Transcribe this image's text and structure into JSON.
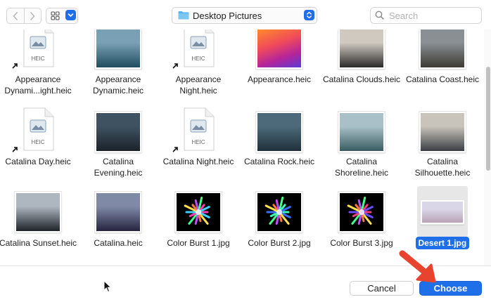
{
  "toolbar": {
    "location_label": "Desktop Pictures",
    "search_placeholder": "Search"
  },
  "files": [
    {
      "name": "Appearance Dynami...ight.heic",
      "kind": "heic",
      "alias": true
    },
    {
      "name": "Appearance Dynamic.heic",
      "kind": "photo",
      "colors": [
        "#7aa0b6",
        "#1f4c5e"
      ]
    },
    {
      "name": "Appearance Night.heic",
      "kind": "heic",
      "alias": true
    },
    {
      "name": "Appearance.heic",
      "kind": "photo",
      "colors": [
        "#f06a2a",
        "#b5249a"
      ]
    },
    {
      "name": "Catalina Clouds.heic",
      "kind": "photo",
      "colors": [
        "#cfc9c0",
        "#2a2a2a"
      ]
    },
    {
      "name": "Catalina Coast.heic",
      "kind": "photo",
      "colors": [
        "#8a8f93",
        "#3c3a33"
      ]
    },
    {
      "name": "Catalina Day.heic",
      "kind": "heic",
      "alias": true
    },
    {
      "name": "Catalina Evening.heic",
      "kind": "photo",
      "colors": [
        "#3e5262",
        "#1c2229"
      ]
    },
    {
      "name": "Catalina Night.heic",
      "kind": "heic",
      "alias": true
    },
    {
      "name": "Catalina Rock.heic",
      "kind": "photo",
      "colors": [
        "#4c6a7a",
        "#20303a"
      ]
    },
    {
      "name": "Catalina Shoreline.heic",
      "kind": "photo",
      "colors": [
        "#a9c0c8",
        "#3a5c62"
      ]
    },
    {
      "name": "Catalina Silhouette.heic",
      "kind": "photo",
      "colors": [
        "#c9c4bb",
        "#3a3e44"
      ]
    },
    {
      "name": "Catalina Sunset.heic",
      "kind": "photo",
      "colors": [
        "#aeb6c0",
        "#1d2328"
      ]
    },
    {
      "name": "Catalina.heic",
      "kind": "photo",
      "colors": [
        "#7f8aa7",
        "#26233f"
      ]
    },
    {
      "name": "Color Burst 1.jpg",
      "kind": "burst",
      "colors": [
        "#ff3cb0",
        "#3fd0ff"
      ]
    },
    {
      "name": "Color Burst 2.jpg",
      "kind": "burst",
      "colors": [
        "#3cffb5",
        "#3c6dff"
      ]
    },
    {
      "name": "Color Burst 3.jpg",
      "kind": "burst",
      "colors": [
        "#ff3c7a",
        "#6c4cff"
      ]
    },
    {
      "name": "Desert 1.jpg",
      "kind": "photo",
      "selected": true,
      "colors": [
        "#d9d7e7",
        "#b9a2b6"
      ]
    }
  ],
  "buttons": {
    "cancel": "Cancel",
    "choose": "Choose"
  },
  "colors": {
    "accent": "#1f6fe8",
    "annotation_arrow": "#e8432f"
  },
  "icons": {
    "back": "chevron-left-icon",
    "forward": "chevron-right-icon",
    "view": "icon-grid-icon",
    "folder": "folder-icon",
    "search": "magnifier-icon",
    "heic": "heic-document-icon",
    "alias": "alias-arrow-icon"
  }
}
